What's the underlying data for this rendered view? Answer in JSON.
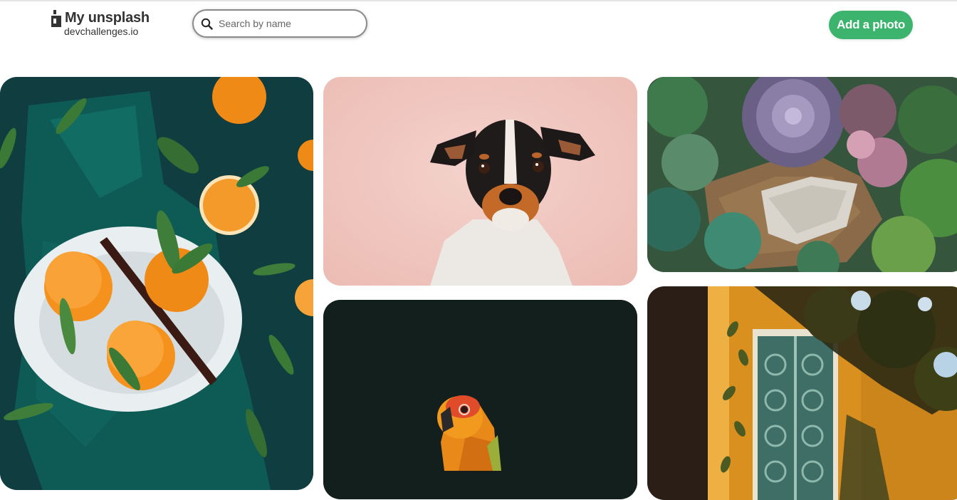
{
  "header": {
    "brand_title": "My unsplash",
    "brand_subtitle": "devchallenges.io",
    "logo_icon": "bottle-logo-icon",
    "search_icon": "search-icon",
    "search_placeholder": "Search by name",
    "search_value": "",
    "add_button_label": "Add a photo",
    "accent_color": "#3db46d"
  },
  "gallery": {
    "photos": [
      {
        "subject": "oranges-on-plate"
      },
      {
        "subject": "dog-portrait"
      },
      {
        "subject": "parrot"
      },
      {
        "subject": "succulents"
      },
      {
        "subject": "window-with-leaves"
      }
    ]
  }
}
